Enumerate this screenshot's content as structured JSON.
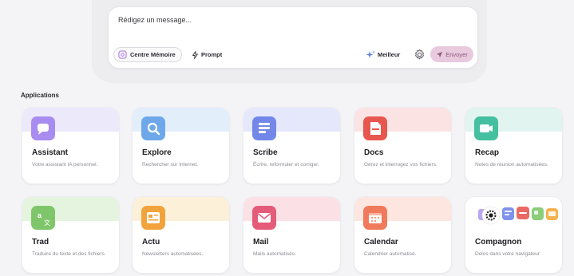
{
  "composer": {
    "placeholder": "Rédigez un message...",
    "memory_label": "Centre Mémoire",
    "prompt_label": "Prompt",
    "better_label": "Meilleur",
    "send_label": "Envoyer"
  },
  "applications": {
    "title": "Applications",
    "apps": [
      {
        "name": "Assistant",
        "desc": "Votre assistant IA personnel.",
        "icon": "chat-bubble-icon",
        "band": "#ece9fb",
        "tile": "#a98cf0"
      },
      {
        "name": "Explore",
        "desc": "Rechercher sur Internet.",
        "icon": "magnifier-icon",
        "band": "#e3eefb",
        "tile": "#6ea8ea"
      },
      {
        "name": "Scribe",
        "desc": "Écrire, reformuler et corriger.",
        "icon": "text-lines-icon",
        "band": "#e5e8fb",
        "tile": "#7387e8"
      },
      {
        "name": "Docs",
        "desc": "Gérez et interrogez vos fichiers.",
        "icon": "document-icon",
        "band": "#fbe3e3",
        "tile": "#e8574f"
      },
      {
        "name": "Recap",
        "desc": "Notes de réunion automatisées.",
        "icon": "video-camera-icon",
        "band": "#e1f4ef",
        "tile": "#44bfa0"
      },
      {
        "name": "Trad",
        "desc": "Traduire du texte et des fichiers.",
        "icon": "translate-icon",
        "band": "#e5f4df",
        "tile": "#7fc66b"
      },
      {
        "name": "Actu",
        "desc": "Newsletters automatisées.",
        "icon": "newspaper-icon",
        "band": "#fdf0d9",
        "tile": "#f2a33c"
      },
      {
        "name": "Mail",
        "desc": "Mails automatisés.",
        "icon": "envelope-icon",
        "band": "#fbe1e6",
        "tile": "#e45c79"
      },
      {
        "name": "Calendar",
        "desc": "Calendrier automatisé.",
        "icon": "calendar-icon",
        "band": "#fde6df",
        "tile": "#f07a5c"
      },
      {
        "name": "Compagnon",
        "desc": "Delos dans votre navigateur.",
        "icon": "companion-icon",
        "band": "#ffffff",
        "tile": "#ffffff"
      }
    ]
  },
  "colors": {
    "send_bg": "#e8c9de",
    "memory_icon": "#b07ae8",
    "better_icon": "#5b7fe6"
  }
}
